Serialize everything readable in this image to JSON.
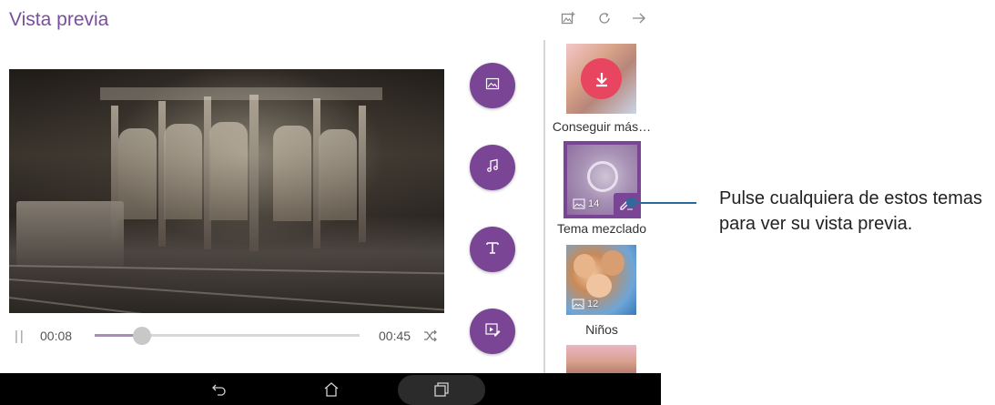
{
  "header": {
    "title": "Vista previa",
    "icons": [
      "add-photo-icon",
      "refresh-icon",
      "arrow-right-icon"
    ]
  },
  "player": {
    "current_time": "00:08",
    "total_time": "00:45",
    "progress": 0.18
  },
  "side_actions": [
    "image-icon",
    "music-note-icon",
    "text-icon",
    "edit-clip-icon"
  ],
  "themes": [
    {
      "label": "Conseguir más…",
      "icon": "download-icon"
    },
    {
      "label": "Tema mezclado",
      "count": "14",
      "selected": true
    },
    {
      "label": "Niños",
      "count": "12"
    }
  ],
  "callout": {
    "text": "Pulse cualquiera de estos temas para ver su vista previa."
  },
  "colors": {
    "accent": "#7a4594",
    "title": "#7a4ea0",
    "download": "#e84560",
    "callout_line": "#2e6a9c"
  }
}
